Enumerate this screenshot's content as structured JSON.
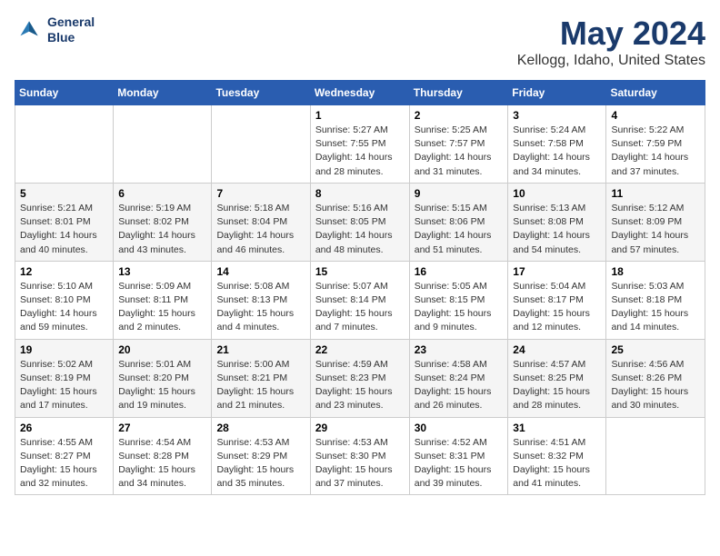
{
  "header": {
    "logo_line1": "General",
    "logo_line2": "Blue",
    "month": "May 2024",
    "location": "Kellogg, Idaho, United States"
  },
  "days_of_week": [
    "Sunday",
    "Monday",
    "Tuesday",
    "Wednesday",
    "Thursday",
    "Friday",
    "Saturday"
  ],
  "weeks": [
    [
      {
        "day": "",
        "info": ""
      },
      {
        "day": "",
        "info": ""
      },
      {
        "day": "",
        "info": ""
      },
      {
        "day": "1",
        "info": "Sunrise: 5:27 AM\nSunset: 7:55 PM\nDaylight: 14 hours\nand 28 minutes."
      },
      {
        "day": "2",
        "info": "Sunrise: 5:25 AM\nSunset: 7:57 PM\nDaylight: 14 hours\nand 31 minutes."
      },
      {
        "day": "3",
        "info": "Sunrise: 5:24 AM\nSunset: 7:58 PM\nDaylight: 14 hours\nand 34 minutes."
      },
      {
        "day": "4",
        "info": "Sunrise: 5:22 AM\nSunset: 7:59 PM\nDaylight: 14 hours\nand 37 minutes."
      }
    ],
    [
      {
        "day": "5",
        "info": "Sunrise: 5:21 AM\nSunset: 8:01 PM\nDaylight: 14 hours\nand 40 minutes."
      },
      {
        "day": "6",
        "info": "Sunrise: 5:19 AM\nSunset: 8:02 PM\nDaylight: 14 hours\nand 43 minutes."
      },
      {
        "day": "7",
        "info": "Sunrise: 5:18 AM\nSunset: 8:04 PM\nDaylight: 14 hours\nand 46 minutes."
      },
      {
        "day": "8",
        "info": "Sunrise: 5:16 AM\nSunset: 8:05 PM\nDaylight: 14 hours\nand 48 minutes."
      },
      {
        "day": "9",
        "info": "Sunrise: 5:15 AM\nSunset: 8:06 PM\nDaylight: 14 hours\nand 51 minutes."
      },
      {
        "day": "10",
        "info": "Sunrise: 5:13 AM\nSunset: 8:08 PM\nDaylight: 14 hours\nand 54 minutes."
      },
      {
        "day": "11",
        "info": "Sunrise: 5:12 AM\nSunset: 8:09 PM\nDaylight: 14 hours\nand 57 minutes."
      }
    ],
    [
      {
        "day": "12",
        "info": "Sunrise: 5:10 AM\nSunset: 8:10 PM\nDaylight: 14 hours\nand 59 minutes."
      },
      {
        "day": "13",
        "info": "Sunrise: 5:09 AM\nSunset: 8:11 PM\nDaylight: 15 hours\nand 2 minutes."
      },
      {
        "day": "14",
        "info": "Sunrise: 5:08 AM\nSunset: 8:13 PM\nDaylight: 15 hours\nand 4 minutes."
      },
      {
        "day": "15",
        "info": "Sunrise: 5:07 AM\nSunset: 8:14 PM\nDaylight: 15 hours\nand 7 minutes."
      },
      {
        "day": "16",
        "info": "Sunrise: 5:05 AM\nSunset: 8:15 PM\nDaylight: 15 hours\nand 9 minutes."
      },
      {
        "day": "17",
        "info": "Sunrise: 5:04 AM\nSunset: 8:17 PM\nDaylight: 15 hours\nand 12 minutes."
      },
      {
        "day": "18",
        "info": "Sunrise: 5:03 AM\nSunset: 8:18 PM\nDaylight: 15 hours\nand 14 minutes."
      }
    ],
    [
      {
        "day": "19",
        "info": "Sunrise: 5:02 AM\nSunset: 8:19 PM\nDaylight: 15 hours\nand 17 minutes."
      },
      {
        "day": "20",
        "info": "Sunrise: 5:01 AM\nSunset: 8:20 PM\nDaylight: 15 hours\nand 19 minutes."
      },
      {
        "day": "21",
        "info": "Sunrise: 5:00 AM\nSunset: 8:21 PM\nDaylight: 15 hours\nand 21 minutes."
      },
      {
        "day": "22",
        "info": "Sunrise: 4:59 AM\nSunset: 8:23 PM\nDaylight: 15 hours\nand 23 minutes."
      },
      {
        "day": "23",
        "info": "Sunrise: 4:58 AM\nSunset: 8:24 PM\nDaylight: 15 hours\nand 26 minutes."
      },
      {
        "day": "24",
        "info": "Sunrise: 4:57 AM\nSunset: 8:25 PM\nDaylight: 15 hours\nand 28 minutes."
      },
      {
        "day": "25",
        "info": "Sunrise: 4:56 AM\nSunset: 8:26 PM\nDaylight: 15 hours\nand 30 minutes."
      }
    ],
    [
      {
        "day": "26",
        "info": "Sunrise: 4:55 AM\nSunset: 8:27 PM\nDaylight: 15 hours\nand 32 minutes."
      },
      {
        "day": "27",
        "info": "Sunrise: 4:54 AM\nSunset: 8:28 PM\nDaylight: 15 hours\nand 34 minutes."
      },
      {
        "day": "28",
        "info": "Sunrise: 4:53 AM\nSunset: 8:29 PM\nDaylight: 15 hours\nand 35 minutes."
      },
      {
        "day": "29",
        "info": "Sunrise: 4:53 AM\nSunset: 8:30 PM\nDaylight: 15 hours\nand 37 minutes."
      },
      {
        "day": "30",
        "info": "Sunrise: 4:52 AM\nSunset: 8:31 PM\nDaylight: 15 hours\nand 39 minutes."
      },
      {
        "day": "31",
        "info": "Sunrise: 4:51 AM\nSunset: 8:32 PM\nDaylight: 15 hours\nand 41 minutes."
      },
      {
        "day": "",
        "info": ""
      }
    ]
  ]
}
